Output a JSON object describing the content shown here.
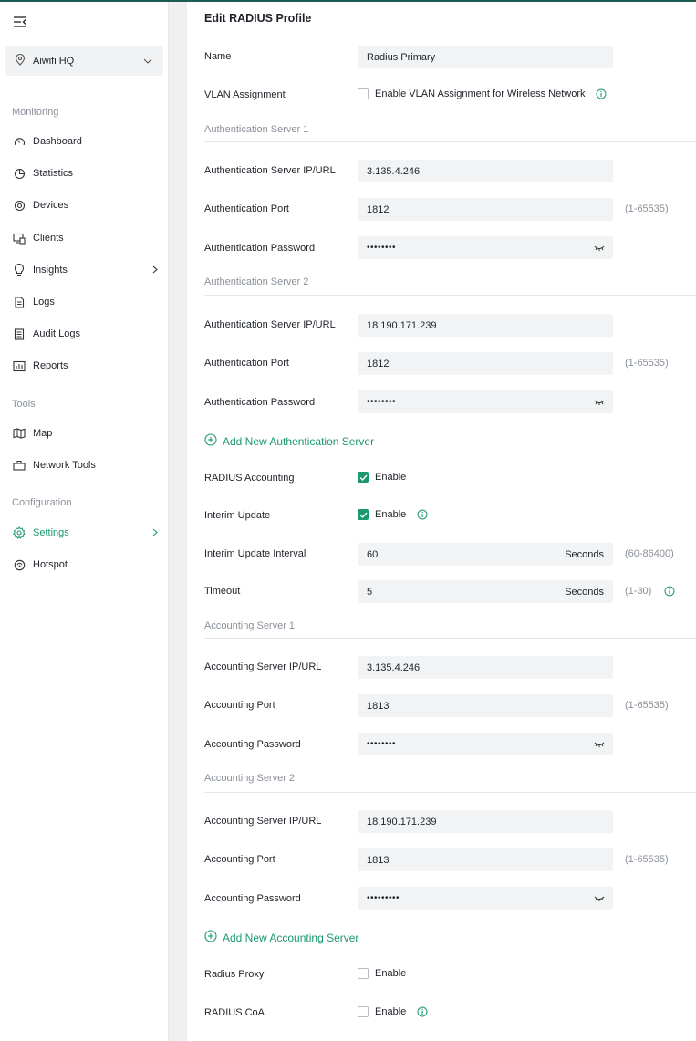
{
  "colors": {
    "accent": "#1a9a6c",
    "brand_dark": "#1e5b52",
    "muted": "#8a9099"
  },
  "sidebar": {
    "site": "Aiwifi HQ",
    "sections": {
      "monitoring": "Monitoring",
      "tools": "Tools",
      "configuration": "Configuration"
    },
    "items": [
      {
        "label": "Dashboard",
        "icon": "dashboard-icon"
      },
      {
        "label": "Statistics",
        "icon": "statistics-icon"
      },
      {
        "label": "Devices",
        "icon": "devices-icon"
      },
      {
        "label": "Clients",
        "icon": "clients-icon"
      },
      {
        "label": "Insights",
        "icon": "insights-icon"
      },
      {
        "label": "Logs",
        "icon": "logs-icon"
      },
      {
        "label": "Audit Logs",
        "icon": "audit-logs-icon"
      },
      {
        "label": "Reports",
        "icon": "reports-icon"
      },
      {
        "label": "Map",
        "icon": "map-icon"
      },
      {
        "label": "Network Tools",
        "icon": "network-tools-icon"
      },
      {
        "label": "Settings",
        "icon": "settings-icon"
      },
      {
        "label": "Hotspot",
        "icon": "hotspot-icon"
      }
    ]
  },
  "form": {
    "title": "Edit RADIUS Profile",
    "name_label": "Name",
    "name_value": "Radius Primary",
    "vlan_label": "VLAN Assignment",
    "vlan_checkbox": "Enable VLAN Assignment for Wireless Network",
    "auth1": {
      "heading": "Authentication Server 1",
      "ip_label": "Authentication Server IP/URL",
      "ip_value": "3.135.4.246",
      "port_label": "Authentication Port",
      "port_value": "1812",
      "port_hint": "(1-65535)",
      "pass_label": "Authentication Password",
      "pass_value": "••••••••"
    },
    "auth2": {
      "heading": "Authentication Server 2",
      "ip_label": "Authentication Server IP/URL",
      "ip_value": "18.190.171.239",
      "port_label": "Authentication Port",
      "port_value": "1812",
      "port_hint": "(1-65535)",
      "pass_label": "Authentication Password",
      "pass_value": "••••••••"
    },
    "add_auth": "Add New Authentication Server",
    "accounting_label": "RADIUS Accounting",
    "accounting_cb": "Enable",
    "accounting_checked": true,
    "interim_label": "Interim Update",
    "interim_cb": "Enable",
    "interim_checked": true,
    "interval_label": "Interim Update Interval",
    "interval_value": "60",
    "interval_unit": "Seconds",
    "interval_hint": "(60-86400)",
    "timeout_label": "Timeout",
    "timeout_value": "5",
    "timeout_unit": "Seconds",
    "timeout_hint": "(1-30)",
    "acct1": {
      "heading": "Accounting Server 1",
      "ip_label": "Accounting Server IP/URL",
      "ip_value": "3.135.4.246",
      "port_label": "Accounting Port",
      "port_value": "1813",
      "port_hint": "(1-65535)",
      "pass_label": "Accounting Password",
      "pass_value": "••••••••"
    },
    "acct2": {
      "heading": "Accounting Server 2",
      "ip_label": "Accounting Server IP/URL",
      "ip_value": "18.190.171.239",
      "port_label": "Accounting Port",
      "port_value": "1813",
      "port_hint": "(1-65535)",
      "pass_label": "Accounting Password",
      "pass_value": "•••••••••"
    },
    "add_acct": "Add New Accounting Server",
    "proxy_label": "Radius Proxy",
    "proxy_cb": "Enable",
    "coa_label": "RADIUS CoA",
    "coa_cb": "Enable"
  }
}
